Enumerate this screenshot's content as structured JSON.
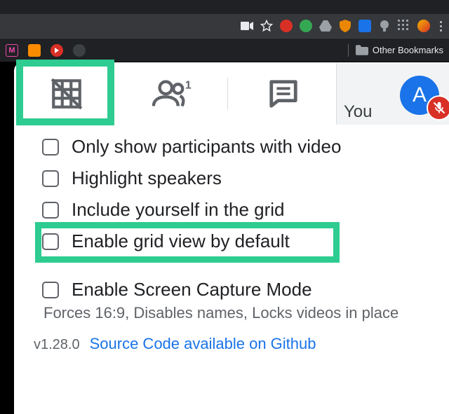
{
  "bookmarks_folder_label": "Other Bookmarks",
  "you_label": "You",
  "avatar_initial": "A",
  "options": [
    "Only show participants with video",
    "Highlight speakers",
    "Include yourself in the grid",
    "Enable grid view by default"
  ],
  "capture_option": "Enable Screen Capture Mode",
  "capture_sub": "Forces 16:9, Disables names, Locks videos in place",
  "version": "v1.28.0",
  "source_link": "Source Code available on Github",
  "toolbar_icons": [
    "camera",
    "star",
    "shield",
    "sync",
    "drive",
    "superman",
    "books",
    "bulb",
    "grid",
    "avatar"
  ],
  "bookmark_icons": [
    "myntra",
    "yt-orange",
    "yt-red",
    "dark"
  ],
  "colors": {
    "highlight": "#2ecc91",
    "link": "#1a73e8",
    "avatar": "#1a73e8",
    "mute": "#d93025"
  }
}
